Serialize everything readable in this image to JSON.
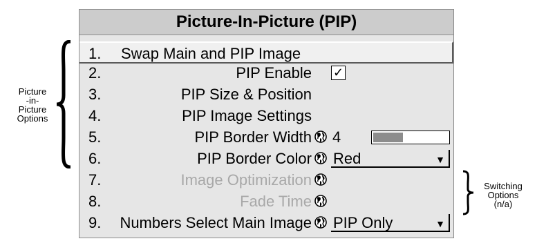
{
  "menu": {
    "title": "Picture-In-Picture (PIP)",
    "items": [
      {
        "number": "1.",
        "label": "Swap Main and PIP Image"
      },
      {
        "number": "2.",
        "label": "PIP Enable",
        "checked": true,
        "check_mark": "✓"
      },
      {
        "number": "3.",
        "label": "PIP Size & Position"
      },
      {
        "number": "4.",
        "label": "PIP Image Settings"
      },
      {
        "number": "5.",
        "label": "PIP Border Width",
        "value": "4",
        "slider_fraction": 0.38
      },
      {
        "number": "6.",
        "label": "PIP Border Color",
        "value": "Red"
      },
      {
        "number": "7.",
        "label": "Image Optimization"
      },
      {
        "number": "8.",
        "label": "Fade Time"
      },
      {
        "number": "9.",
        "label": "Numbers Select Main Image",
        "value": "PIP Only"
      }
    ],
    "dropdown_arrow": "▼"
  },
  "annotations": {
    "left": [
      "Picture",
      "-in-",
      "Picture",
      "Options"
    ],
    "right": [
      "Switching",
      "Options",
      "(n/a)"
    ]
  },
  "colors": {
    "menu_bg": "#e6e6e6",
    "title_bg": "#cccccc",
    "disabled_text": "#a8a8a8",
    "slider_fill": "#8c8c8c"
  }
}
